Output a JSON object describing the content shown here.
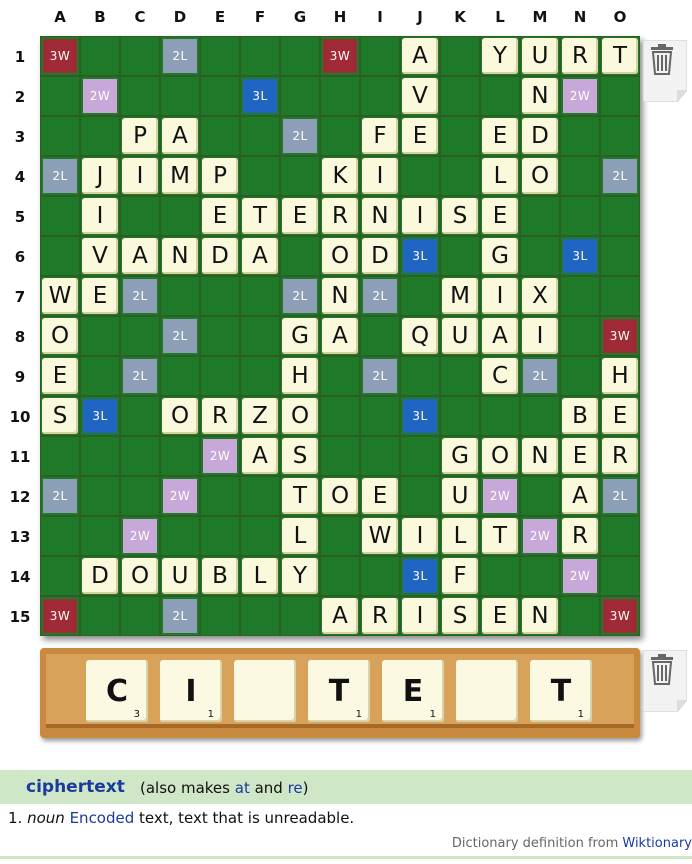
{
  "columns": [
    "A",
    "B",
    "C",
    "D",
    "E",
    "F",
    "G",
    "H",
    "I",
    "J",
    "K",
    "L",
    "M",
    "N",
    "O"
  ],
  "rows": [
    "1",
    "2",
    "3",
    "4",
    "5",
    "6",
    "7",
    "8",
    "9",
    "10",
    "11",
    "12",
    "13",
    "14",
    "15"
  ],
  "premium_labels": {
    "3W": "3W",
    "2W": "2W",
    "3L": "3L",
    "2L": "2L"
  },
  "board": [
    "*..d...*..A.YURT",
    "",
    "",
    "",
    "",
    "",
    "",
    "",
    "",
    "",
    "",
    "",
    "",
    "",
    ""
  ],
  "tiles": [
    [
      "J1",
      "A"
    ],
    [
      "L1",
      "Y"
    ],
    [
      "M1",
      "U"
    ],
    [
      "N1",
      "R"
    ],
    [
      "O1",
      "T"
    ],
    [
      "J2",
      "V"
    ],
    [
      "M2",
      "N"
    ],
    [
      "C3",
      "P"
    ],
    [
      "D3",
      "A"
    ],
    [
      "I3",
      "F"
    ],
    [
      "J3",
      "E"
    ],
    [
      "L3",
      "E"
    ],
    [
      "M3",
      "D"
    ],
    [
      "B4",
      "J"
    ],
    [
      "C4",
      "I"
    ],
    [
      "D4",
      "M"
    ],
    [
      "E4",
      "P"
    ],
    [
      "H4",
      "K"
    ],
    [
      "I4",
      "I"
    ],
    [
      "L4",
      "L"
    ],
    [
      "M4",
      "O"
    ],
    [
      "B5",
      "I"
    ],
    [
      "E5",
      "E"
    ],
    [
      "F5",
      "T"
    ],
    [
      "G5",
      "E"
    ],
    [
      "H5",
      "R"
    ],
    [
      "I5",
      "N"
    ],
    [
      "J5",
      "I"
    ],
    [
      "K5",
      "S"
    ],
    [
      "L5",
      "E"
    ],
    [
      "B6",
      "V"
    ],
    [
      "C6",
      "A"
    ],
    [
      "D6",
      "N"
    ],
    [
      "E6",
      "D"
    ],
    [
      "F6",
      "A"
    ],
    [
      "H6",
      "O"
    ],
    [
      "I6",
      "D"
    ],
    [
      "L6",
      "G"
    ],
    [
      "A7",
      "W"
    ],
    [
      "B7",
      "E"
    ],
    [
      "H7",
      "N"
    ],
    [
      "K7",
      "M"
    ],
    [
      "L7",
      "I"
    ],
    [
      "M7",
      "X"
    ],
    [
      "A8",
      "O"
    ],
    [
      "G8",
      "G"
    ],
    [
      "H8",
      "A"
    ],
    [
      "J8",
      "Q"
    ],
    [
      "K8",
      "U"
    ],
    [
      "L8",
      "A"
    ],
    [
      "M8",
      "I"
    ],
    [
      "A9",
      "E"
    ],
    [
      "G9",
      "H"
    ],
    [
      "L9",
      "C"
    ],
    [
      "O9",
      "H"
    ],
    [
      "A10",
      "S"
    ],
    [
      "D10",
      "O"
    ],
    [
      "E10",
      "R"
    ],
    [
      "F10",
      "Z"
    ],
    [
      "G10",
      "O"
    ],
    [
      "N10",
      "B"
    ],
    [
      "O10",
      "E"
    ],
    [
      "F11",
      "A"
    ],
    [
      "G11",
      "S"
    ],
    [
      "K11",
      "G"
    ],
    [
      "L11",
      "O"
    ],
    [
      "M11",
      "N"
    ],
    [
      "N11",
      "E"
    ],
    [
      "O11",
      "R"
    ],
    [
      "G12",
      "T"
    ],
    [
      "H12",
      "O"
    ],
    [
      "I12",
      "E"
    ],
    [
      "K12",
      "U"
    ],
    [
      "N12",
      "A"
    ],
    [
      "G13",
      "L"
    ],
    [
      "I13",
      "W"
    ],
    [
      "J13",
      "I"
    ],
    [
      "K13",
      "L"
    ],
    [
      "L13",
      "T"
    ],
    [
      "N13",
      "R"
    ],
    [
      "B14",
      "D"
    ],
    [
      "C14",
      "O"
    ],
    [
      "D14",
      "U"
    ],
    [
      "E14",
      "B"
    ],
    [
      "F14",
      "L"
    ],
    [
      "G14",
      "Y"
    ],
    [
      "K14",
      "F"
    ],
    [
      "H15",
      "A"
    ],
    [
      "I15",
      "R"
    ],
    [
      "J15",
      "I"
    ],
    [
      "K15",
      "S"
    ],
    [
      "L15",
      "E"
    ],
    [
      "M15",
      "N"
    ]
  ],
  "premiums": [
    [
      "A1",
      "3W"
    ],
    [
      "D1",
      "2L"
    ],
    [
      "H1",
      "3W"
    ],
    [
      "B2",
      "2W"
    ],
    [
      "F2",
      "3L"
    ],
    [
      "N2",
      "2W"
    ],
    [
      "G3",
      "2L"
    ],
    [
      "A4",
      "2L"
    ],
    [
      "O4",
      "2L"
    ],
    [
      "J6",
      "3L"
    ],
    [
      "N6",
      "3L"
    ],
    [
      "C7",
      "2L"
    ],
    [
      "G7",
      "2L"
    ],
    [
      "I7",
      "2L"
    ],
    [
      "D8",
      "2L"
    ],
    [
      "O8",
      "3W"
    ],
    [
      "C9",
      "2L"
    ],
    [
      "I9",
      "2L"
    ],
    [
      "M9",
      "2L"
    ],
    [
      "B10",
      "3L"
    ],
    [
      "J10",
      "3L"
    ],
    [
      "E11",
      "2W"
    ],
    [
      "A12",
      "2L"
    ],
    [
      "D12",
      "2W"
    ],
    [
      "L12",
      "2W"
    ],
    [
      "O12",
      "2L"
    ],
    [
      "C13",
      "2W"
    ],
    [
      "M13",
      "2W"
    ],
    [
      "J14",
      "3L"
    ],
    [
      "N14",
      "2W"
    ],
    [
      "A15",
      "3W"
    ],
    [
      "D15",
      "2L"
    ],
    [
      "O15",
      "3W"
    ]
  ],
  "rack": [
    {
      "letter": "C",
      "points": "3"
    },
    {
      "letter": "I",
      "points": "1"
    },
    {
      "letter": "",
      "points": ""
    },
    {
      "letter": "T",
      "points": "1"
    },
    {
      "letter": "E",
      "points": "1"
    },
    {
      "letter": "",
      "points": ""
    },
    {
      "letter": "T",
      "points": "1"
    }
  ],
  "definition": {
    "word": "ciphertext",
    "also_prefix": "(also makes ",
    "also_word1": "at",
    "also_and": " and ",
    "also_word2": "re",
    "also_suffix": ")",
    "number": "1.",
    "pos": "noun",
    "link_word": "Encoded",
    "text": " text, text that is unreadable.",
    "source_prefix": "Dictionary definition from ",
    "source_link": "Wiktionary"
  },
  "colors": {
    "tile": "#fbf9dc",
    "board": "#1e7a28",
    "tw": "#a02a36",
    "dw": "#c8a7d9",
    "tl": "#1f66c4",
    "dl": "#8d9fb7",
    "link": "#1a3aa0"
  }
}
